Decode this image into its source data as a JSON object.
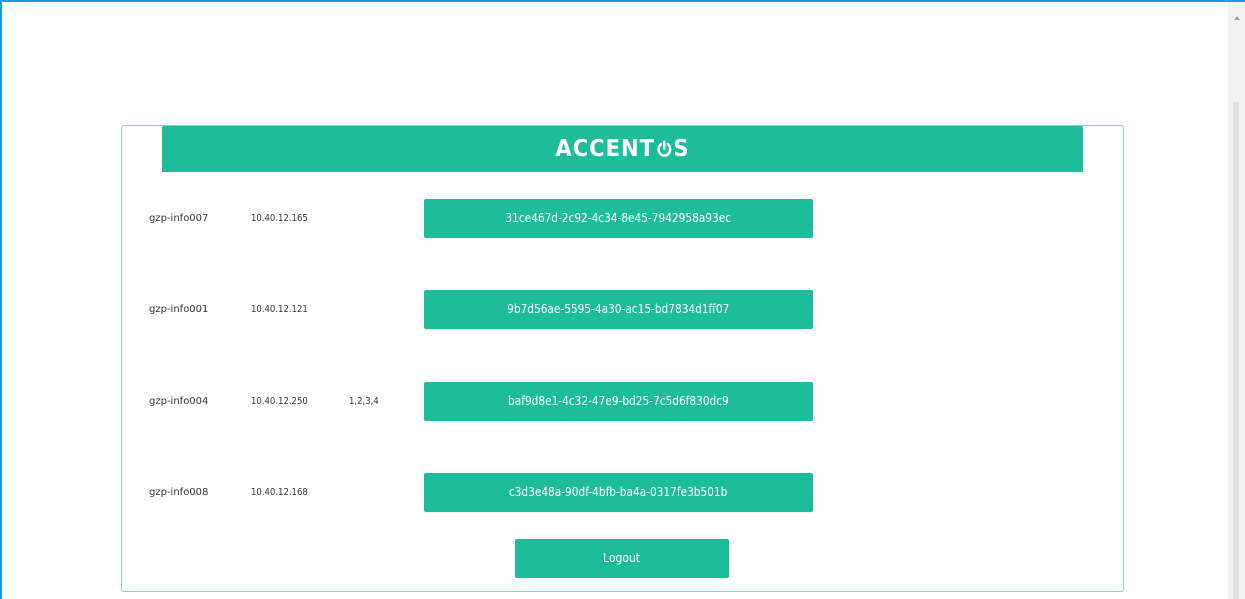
{
  "header": {
    "logo_prefix": "ACCENT",
    "logo_suffix": "S"
  },
  "colors": {
    "accent": "#1dbd9a",
    "panel_border": "#7fd5c9",
    "window_border": "#1e9ad6"
  },
  "sessions": [
    {
      "host": "gzp-info007",
      "ip": "10.40.12.165",
      "extra": "",
      "uuid": "31ce467d-2c92-4c34-8e45-7942958a93ec"
    },
    {
      "host": "gzp-info001",
      "ip": "10.40.12.121",
      "extra": "",
      "uuid": "9b7d56ae-5595-4a30-ac15-bd7834d1ff07"
    },
    {
      "host": "gzp-info004",
      "ip": "10.40.12.250",
      "extra": "1,2,3,4",
      "uuid": "baf9d8e1-4c32-47e9-bd25-7c5d6f830dc9"
    },
    {
      "host": "gzp-info008",
      "ip": "10.40.12.168",
      "extra": "",
      "uuid": "c3d3e48a-90df-4bfb-ba4a-0317fe3b501b"
    }
  ],
  "logout_label": "Logout"
}
